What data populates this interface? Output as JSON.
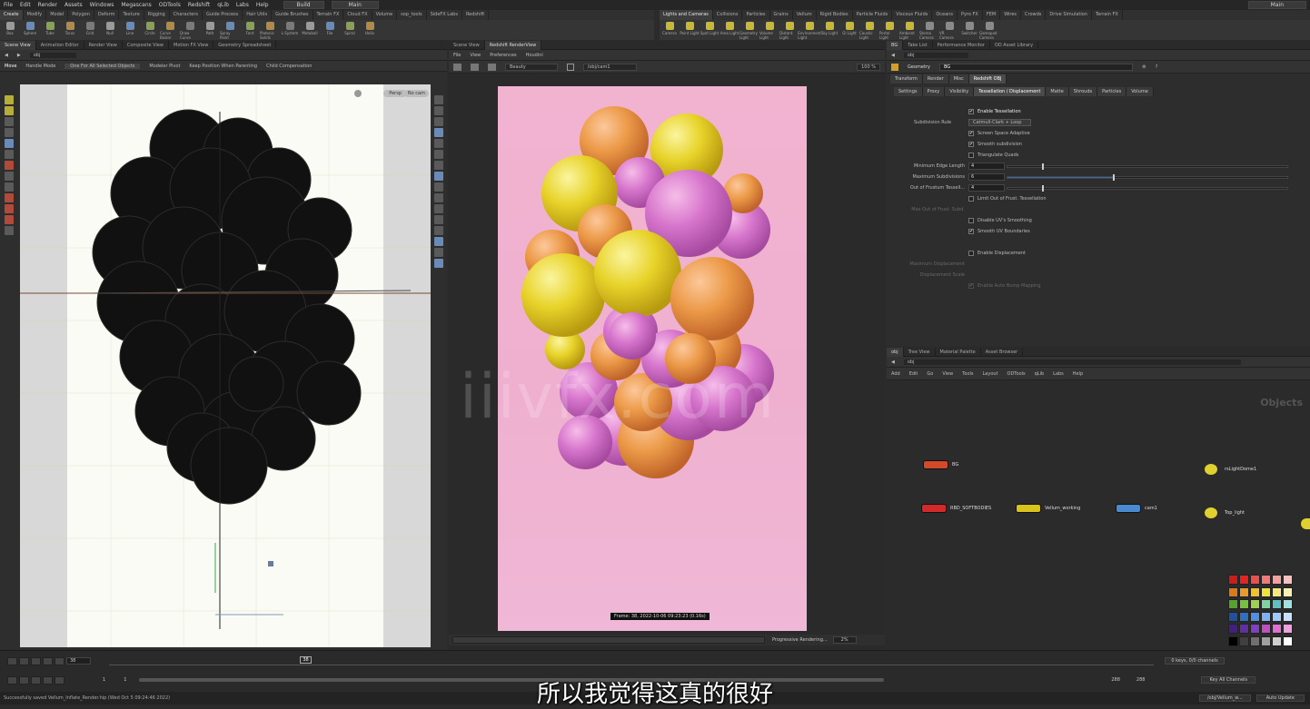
{
  "menubar": {
    "items": [
      "File",
      "Edit",
      "Render",
      "Assets",
      "Windows",
      "Megascans",
      "ODTools",
      "Redshift",
      "qLib",
      "Labs",
      "Help"
    ],
    "desktop": "Build",
    "scene": "Main",
    "user": "Main"
  },
  "shelf": {
    "left_tabs": [
      "Create",
      "Modify",
      "Model",
      "Polygon",
      "Deform",
      "Texture",
      "Rigging",
      "Characters",
      "Guide Process",
      "Hair Utils",
      "Guide Brushes",
      "Terrain FX",
      "Cloud FX",
      "Volume",
      "sop_tools",
      "SideFX Labs",
      "Redshift"
    ],
    "right_tabs": [
      "Lights and Cameras",
      "Collisions",
      "Particles",
      "Grains",
      "Vellum",
      "Rigid Bodies",
      "Particle Fluids",
      "Viscous Fluids",
      "Oceans",
      "Pyro FX",
      "FEM",
      "Wires",
      "Crowds",
      "Drive Simulation",
      "Terrain FX"
    ],
    "left_tools": [
      "Box",
      "Sphere",
      "Tube",
      "Torus",
      "Grid",
      "Null",
      "Line",
      "Circle",
      "Curve Bezier",
      "Draw Curve",
      "Path",
      "Spray Paint",
      "Font",
      "Platonic Solids",
      "L-System",
      "Metaball",
      "File",
      "Spiral",
      "Helix"
    ],
    "right_tools": [
      "Camera",
      "Point Light",
      "Spot Light",
      "Area Light",
      "Geometry Light",
      "Volume Light",
      "Distant Light",
      "Environment Light",
      "Sky Light",
      "GI Light",
      "Caustic Light",
      "Portal Light",
      "Ambient Light",
      "Stereo Camera",
      "VR Camera",
      "Switcher",
      "Gamepad Camera"
    ]
  },
  "viewport": {
    "tabs": [
      "Scene View",
      "Animation Editor",
      "Render View",
      "Composite View",
      "Motion FX View",
      "Geometry Spreadsheet"
    ],
    "path": "obj",
    "toolbar": [
      "Move",
      "Handle Mode",
      "One For All Selected Objects",
      "Modeler Pivot",
      "Keep Position When Parenting",
      "Child Compensation"
    ],
    "view_label": "Persp",
    "cam_label": "No cam"
  },
  "render_view": {
    "tabs": [
      "Scene View",
      "Redshift RenderView"
    ],
    "menu": [
      "File",
      "View",
      "Preferences",
      "Houdini"
    ],
    "beauty": "Beauty",
    "camera": "/obj/cam1",
    "zoom": "100 %",
    "frame_info": "Frame: 38,  2022-10-06  09:23:23  (0.16s)",
    "status_label": "Progressive Rendering...",
    "progress": "2%"
  },
  "params": {
    "tabs": [
      "BG",
      "Take List",
      "Performance Monitor",
      "OD Asset Library"
    ],
    "path": "obj",
    "node_type": "Geometry",
    "node_name": "BG",
    "main_tabs": [
      "Transform",
      "Render",
      "Misc",
      "Redshift OBJ"
    ],
    "sub_tabs": [
      "Settings",
      "Proxy",
      "Visibility",
      "Tessellation / Displacement",
      "Matte",
      "Shrouds",
      "Particles",
      "Volume"
    ],
    "enable_tessellation": "Enable Tessellation",
    "subdivision_rule_label": "Subdivision Rule",
    "subdivision_rule_value": "Catmull-Clark + Loop",
    "screen_space": "Screen Space Adaptive",
    "smooth_subdivision": "Smooth subdivision",
    "triangulate": "Triangulate Quads",
    "min_edge_label": "Minimum Edge Length",
    "min_edge_value": "4",
    "max_subdiv_label": "Maximum Subdivisions",
    "max_subdiv_value": "6",
    "oof_label": "Out of Frustum Tessell...",
    "oof_value": "4",
    "limit_oof": "Limit Out of Frust. Tessellation",
    "max_oof_label": "Max Out of Frust. Subd.",
    "disable_uv": "Disable UV's Smoothing",
    "smooth_uv": "Smooth UV Boundaries",
    "enable_disp": "Enable Displacement",
    "disp_max_label": "Maximum Displacement",
    "disp_scale_label": "Displacement Scale",
    "auto_bump": "Enable Auto Bump Mapping"
  },
  "network": {
    "tabs": [
      "obj",
      "Tree View",
      "Material Palette",
      "Asset Browser"
    ],
    "path": "obj",
    "menu": [
      "Add",
      "Edit",
      "Go",
      "View",
      "Tools",
      "Layout",
      "ODTools",
      "qLib",
      "Labs",
      "Help"
    ],
    "context_label": "Objects",
    "nodes": [
      {
        "name": "BG",
        "color": "#d24a2a",
        "kind": "geo"
      },
      {
        "name": "RBD_SOFTBODIES",
        "color": "#d22a2a",
        "kind": "geo"
      },
      {
        "name": "Vellum_working",
        "color": "#d8c31c",
        "kind": "geo"
      },
      {
        "name": "cam1",
        "color": "#4a8ad0",
        "kind": "cam"
      },
      {
        "name": "rsLightDome1",
        "color": "#e0d030",
        "kind": "light"
      },
      {
        "name": "Top_light",
        "color": "#e0d030",
        "kind": "light"
      }
    ]
  },
  "palette": [
    "#c81e1e",
    "#e12424",
    "#e85050",
    "#f07a7a",
    "#f5a0a0",
    "#f7c0c0",
    "#d87a1e",
    "#e89a2a",
    "#f0c030",
    "#f0e040",
    "#f5e880",
    "#f8f0b0",
    "#5aa030",
    "#7ac040",
    "#a0d050",
    "#80d0a0",
    "#60c0c0",
    "#a0e0e0",
    "#2050a0",
    "#3070c0",
    "#5090e0",
    "#80b0f0",
    "#a0c8f8",
    "#c8e0ff",
    "#402080",
    "#6030a0",
    "#8040c0",
    "#c050c0",
    "#e070d0",
    "#f0a0e0",
    "#000000",
    "#404040",
    "#707070",
    "#a0a0a0",
    "#d0d0d0",
    "#ffffff"
  ],
  "timeline": {
    "frame": "38",
    "start": "1",
    "start2": "1",
    "end": "288",
    "end2": "288",
    "keys_label": "0 keys, 0/0 channels",
    "key_all_label": "Key All Channels",
    "auto_update": "Auto Update"
  },
  "status": {
    "message": "Successfully saved Vellum_Inflate_Render.hip (Wed Oct  5 09:24:46 2022)",
    "obj_label": "/obj/Vellum_w..."
  },
  "subtitle": "所以我觉得这真的很好",
  "watermark": "iiivfx.com"
}
